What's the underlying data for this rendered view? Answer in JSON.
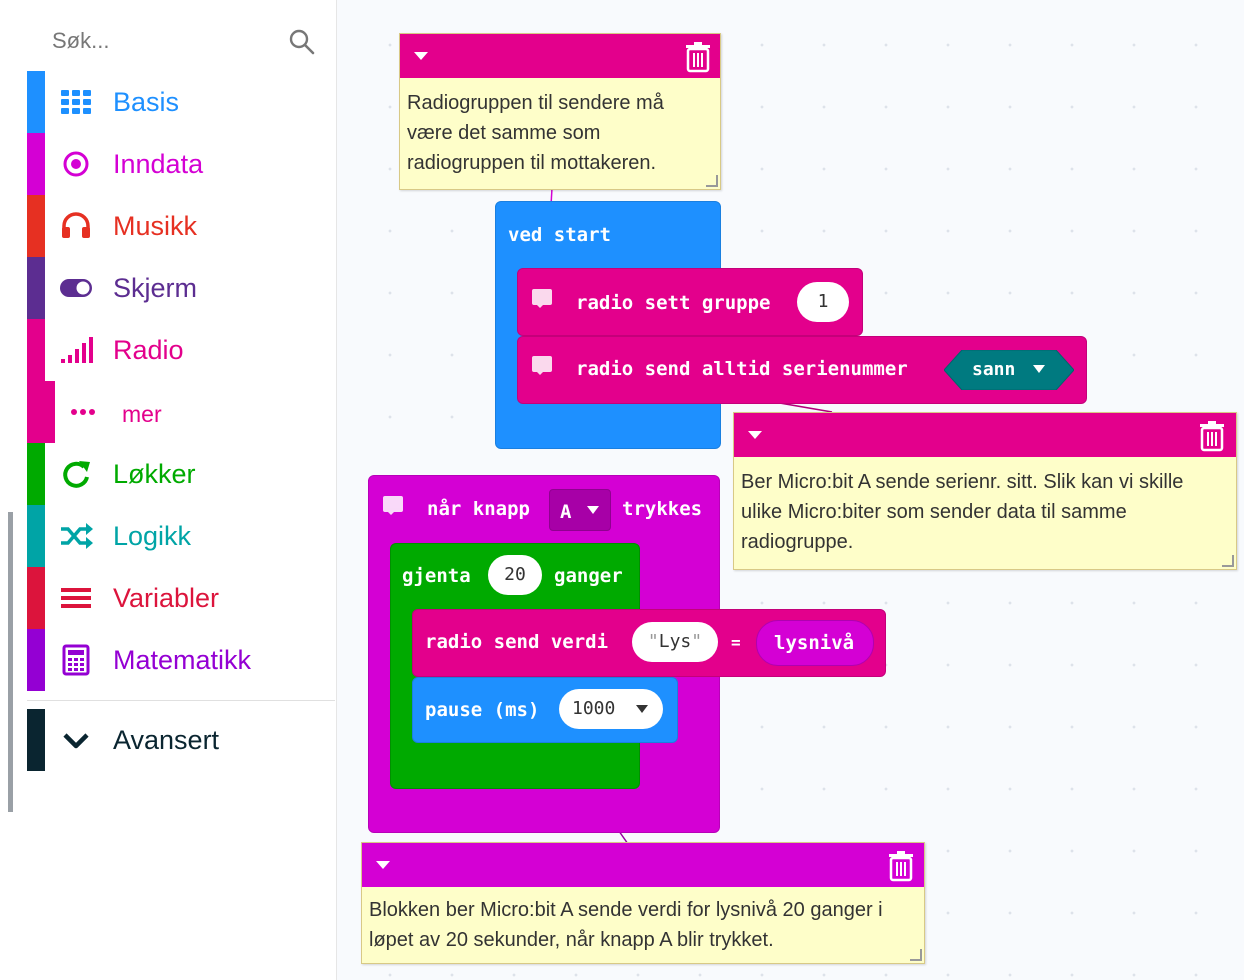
{
  "search": {
    "placeholder": "Søk..."
  },
  "categories": [
    {
      "label": "Basis",
      "color": "#1e90ff",
      "icon": "grid-icon"
    },
    {
      "label": "Inndata",
      "color": "#d400d4",
      "icon": "target-icon"
    },
    {
      "label": "Musikk",
      "color": "#e63022",
      "icon": "headphones-icon"
    },
    {
      "label": "Skjerm",
      "color": "#5c2d91",
      "icon": "toggle-icon"
    },
    {
      "label": "Radio",
      "color": "#e3008c",
      "icon": "signal-bars-icon"
    },
    {
      "label": "mer",
      "color": "#e3008c",
      "icon": "more-dots-icon"
    },
    {
      "label": "Løkker",
      "color": "#00aa00",
      "icon": "loop-icon"
    },
    {
      "label": "Logikk",
      "color": "#00a4a6",
      "icon": "shuffle-icon"
    },
    {
      "label": "Variabler",
      "color": "#dc143c",
      "icon": "lines-icon"
    },
    {
      "label": "Matematikk",
      "color": "#9400d3",
      "icon": "calculator-icon"
    }
  ],
  "advanced": {
    "label": "Avansert",
    "color": "#0a2530",
    "icon": "chevron-down-icon"
  },
  "blocks": {
    "on_start": {
      "label": "ved start",
      "color": "#1e90ff"
    },
    "radio_set_group": {
      "label": "radio sett gruppe",
      "value": "1",
      "color": "#e3008c"
    },
    "radio_send_serial": {
      "label": "radio send alltid serienummer",
      "value": "sann",
      "color": "#e3008c",
      "value_color": "#007a80"
    },
    "on_button": {
      "prefix": "når knapp",
      "button": "A",
      "suffix": "trykkes",
      "color": "#d400d4"
    },
    "repeat": {
      "prefix": "gjenta",
      "count": "20",
      "suffix": "ganger",
      "color": "#00aa00"
    },
    "radio_send_value": {
      "label": "radio send verdi",
      "name": "Lys",
      "equals": "=",
      "value": "lysnivå",
      "color": "#e3008c",
      "value_color": "#d400d4"
    },
    "pause": {
      "label": "pause (ms)",
      "value": "1000",
      "color": "#1e90ff"
    }
  },
  "comments": [
    {
      "text": "Radiogruppen til sendere må være det samme som radiogruppen til mottakeren.",
      "head_color": "#e3008c"
    },
    {
      "text": "Ber Micro:bit A sende serienr. sitt. Slik kan vi skille ulike Micro:biter som sender data til samme radiogruppe.",
      "head_color": "#e3008c"
    },
    {
      "text": "Blokken ber Micro:bit A sende verdi for lysnivå 20 ganger i løpet av 20 sekunder, når knapp A blir trykket.",
      "head_color": "#d400d4"
    }
  ]
}
